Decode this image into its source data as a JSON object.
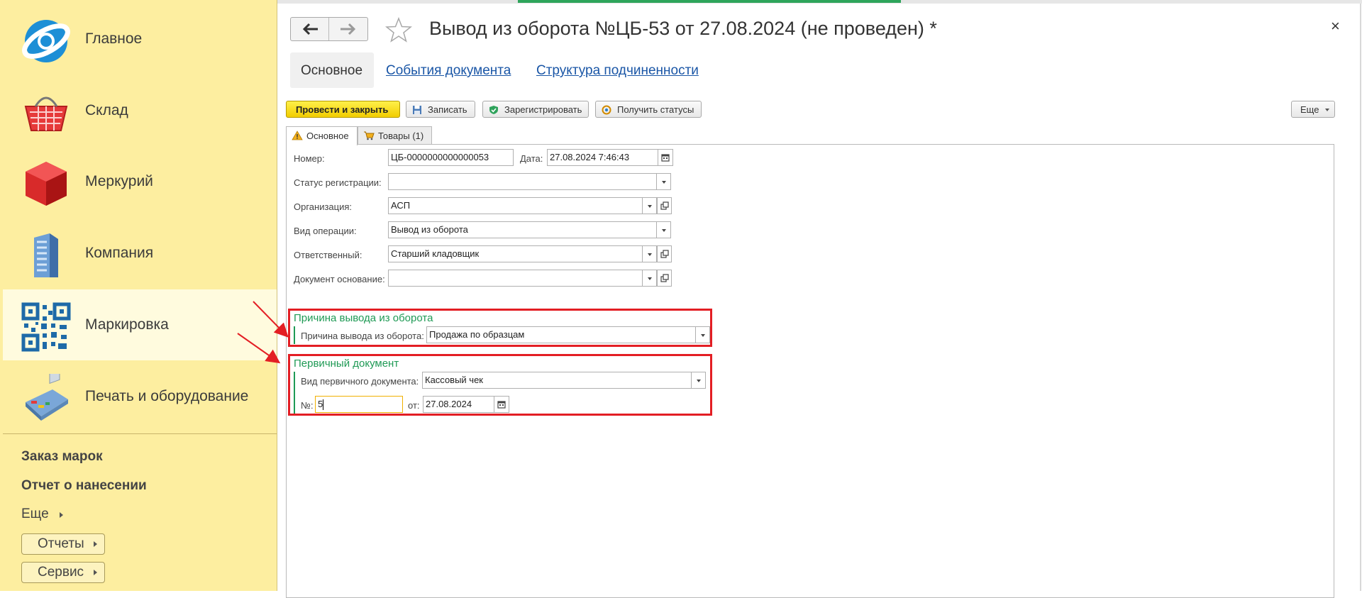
{
  "sidebar": {
    "sections": [
      {
        "label": "Главное",
        "icon": "globe-icon"
      },
      {
        "label": "Склад",
        "icon": "basket-icon"
      },
      {
        "label": "Меркурий",
        "icon": "cube-icon"
      },
      {
        "label": "Компания",
        "icon": "building-icon"
      },
      {
        "label": "Маркировка",
        "icon": "qr-code-icon",
        "active": true
      },
      {
        "label": "Печать и оборудование",
        "icon": "payment-terminal-icon"
      }
    ],
    "links": [
      "Заказ марок",
      "Отчет о нанесении"
    ],
    "more": "Еще",
    "buttons": [
      "Отчеты",
      "Сервис"
    ]
  },
  "window": {
    "title": "Вывод из оборота №ЦБ-53 от 27.08.2024 (не проведен) *",
    "close": "×",
    "nav_tabs": [
      "Основное",
      "События документа",
      "Структура подчиненности"
    ]
  },
  "toolbar": {
    "post_close": "Провести и закрыть",
    "save": "Записать",
    "register": "Зарегистрировать",
    "get_statuses": "Получить статусы",
    "more": "Еще"
  },
  "tabs": [
    "Основное",
    "Товары (1)"
  ],
  "form": {
    "number_label": "Номер:",
    "number_value": "ЦБ-0000000000000053",
    "date_label": "Дата:",
    "date_value": "27.08.2024  7:46:43",
    "status_label": "Статус регистрации:",
    "status_value": "",
    "org_label": "Организация:",
    "org_value": "АСП",
    "op_label": "Вид операции:",
    "op_value": "Вывод из оборота",
    "resp_label": "Ответственный:",
    "resp_value": "Старший кладовщик",
    "basis_label": "Документ основание:",
    "basis_value": ""
  },
  "reason_group": {
    "title": "Причина вывода из оборота",
    "label": "Причина вывода из оборота:",
    "value": "Продажа по образцам"
  },
  "primary_group": {
    "title": "Первичный документ",
    "type_label": "Вид первичного документа:",
    "type_value": "Кассовый чек",
    "num_label": "№:",
    "num_value": "5",
    "from_label": "от:",
    "from_value": "27.08.2024"
  },
  "colors": {
    "sidebar_bg": "#fdeea0",
    "primary_button": "#f7dc1a",
    "group_green": "#1f9a55",
    "highlight_red": "#e31e24",
    "link_blue": "#1a56a6"
  }
}
